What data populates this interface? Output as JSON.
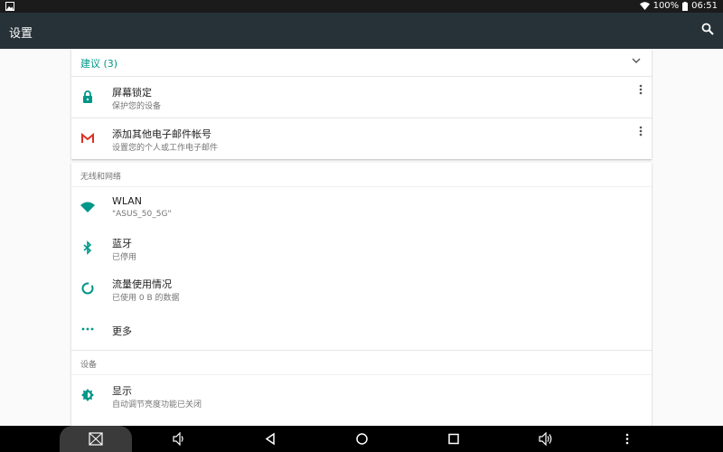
{
  "status": {
    "battery": "100%",
    "time": "06:51"
  },
  "appbar": {
    "title": "设置"
  },
  "suggestions": {
    "header": "建议 (3)",
    "items": [
      {
        "title": "屏幕锁定",
        "subtitle": "保护您的设备",
        "icon": "lock-icon"
      },
      {
        "title": "添加其他电子邮件帐号",
        "subtitle": "设置您的个人或工作电子邮件",
        "icon": "gmail-icon"
      }
    ]
  },
  "wireless": {
    "label": "无线和网络",
    "items": [
      {
        "title": "WLAN",
        "subtitle": "\"ASUS_50_5G\"",
        "icon": "wifi-icon"
      },
      {
        "title": "蓝牙",
        "subtitle": "已停用",
        "icon": "bluetooth-icon"
      },
      {
        "title": "流量使用情况",
        "subtitle": "已使用 0 B 的数据",
        "icon": "data-usage-icon"
      },
      {
        "title": "更多",
        "subtitle": "",
        "icon": "more-horiz-icon"
      }
    ]
  },
  "device": {
    "label": "设备",
    "items": [
      {
        "title": "显示",
        "subtitle": "自动调节亮度功能已关闭",
        "icon": "brightness-icon"
      }
    ]
  },
  "colors": {
    "accent": "#009688",
    "appbar": "#263238",
    "gmail_red": "#d93025"
  }
}
